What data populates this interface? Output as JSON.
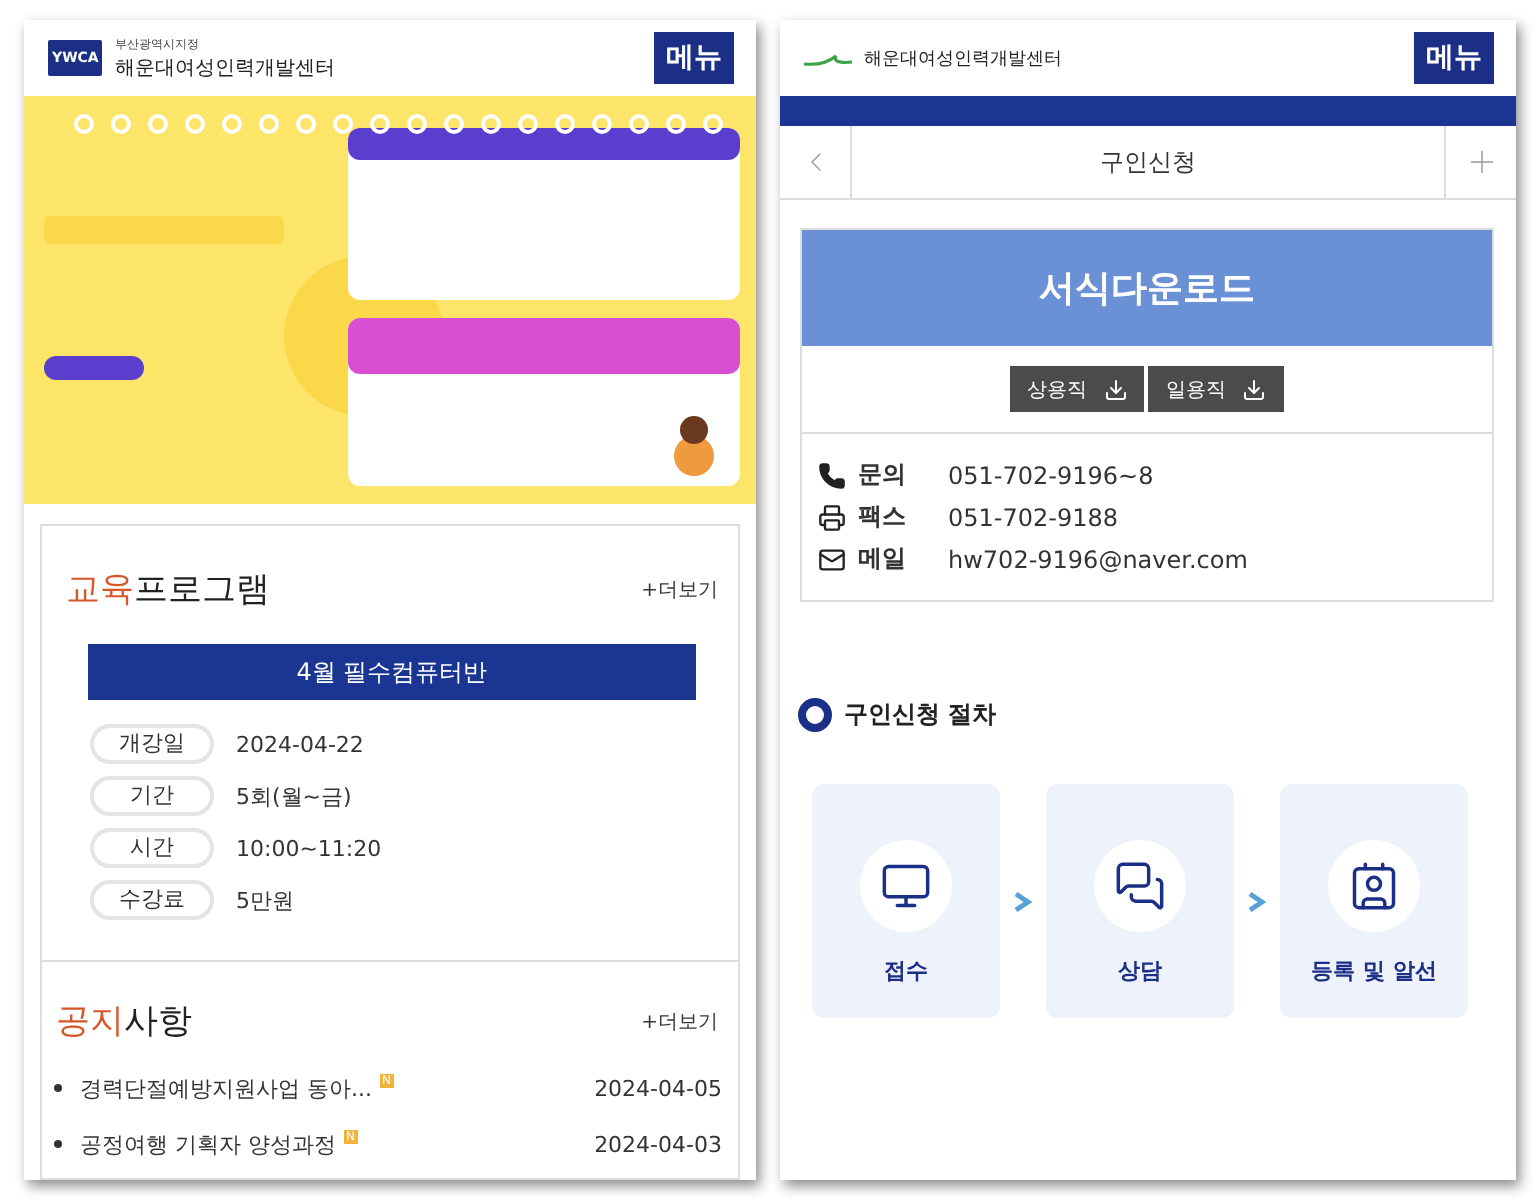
{
  "left_page": {
    "header": {
      "logo": "YWCA",
      "subtitle": "부산광역시지정",
      "title": "해운대여성인력개발센터",
      "menu_button": "메뉴"
    },
    "education": {
      "title_accent": "교육",
      "title_rest": "프로그램",
      "more": "+더보기",
      "program": "4월 필수컴퓨터반",
      "details": [
        {
          "label": "개강일",
          "value": "2024-04-22"
        },
        {
          "label": "기간",
          "value": "5회(월~금)"
        },
        {
          "label": "시간",
          "value": "10:00~11:20"
        },
        {
          "label": "수강료",
          "value": "5만원"
        }
      ]
    },
    "notices": {
      "title_accent": "공지",
      "title_rest": "사항",
      "more": "+더보기",
      "items": [
        {
          "title": "경력단절예방지원사업 동아...",
          "badge": "N",
          "date": "2024-04-05"
        },
        {
          "title": "공정여행 기획자 양성과정",
          "badge": "N",
          "date": "2024-04-03"
        }
      ]
    }
  },
  "right_page": {
    "header": {
      "title": "해운대여성인력개발센터",
      "menu_button": "메뉴"
    },
    "nav": {
      "title": "구인신청"
    },
    "forms": {
      "title": "서식다운로드",
      "buttons": [
        "상용직",
        "일용직"
      ],
      "contacts": [
        {
          "kind": "phone",
          "label": "문의",
          "value": "051-702-9196~8"
        },
        {
          "kind": "fax",
          "label": "팩스",
          "value": "051-702-9188"
        },
        {
          "kind": "mail",
          "label": "메일",
          "value": "hw702-9196@naver.com"
        }
      ]
    },
    "procedure": {
      "title": "구인신청 절차",
      "steps": [
        {
          "kind": "monitor",
          "label": "접수"
        },
        {
          "kind": "chat",
          "label": "상담"
        },
        {
          "kind": "card",
          "label": "등록 및 알선"
        }
      ]
    }
  }
}
